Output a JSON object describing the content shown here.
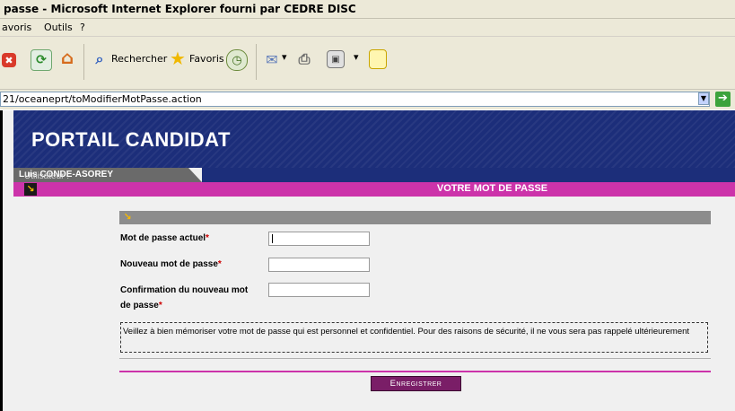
{
  "window": {
    "title": "passe - Microsoft Internet Explorer fourni par CEDRE DISC"
  },
  "menu": {
    "items": [
      "avoris",
      "Outils",
      "?"
    ]
  },
  "toolbar": {
    "search_label": "Rechercher",
    "favorites_label": "Favoris"
  },
  "address": {
    "url": "21/oceaneprt/toModifierMotPasse.action"
  },
  "portal": {
    "title": "PORTAIL CANDIDAT",
    "user_label": "Utilisateur :",
    "user_name": "Luis CONDE-ASOREY"
  },
  "section": {
    "title": "VOTRE MOT DE PASSE"
  },
  "form": {
    "current_password_label": "Mot de passe actuel",
    "new_password_label": "Nouveau mot de passe",
    "confirm_label_line1": "Confirmation du nouveau mot",
    "confirm_label_line2": "de passe",
    "required_mark": "*",
    "current_password_value": "",
    "new_password_value": "",
    "confirm_value": ""
  },
  "notice": {
    "text": "Veillez à bien mémoriser votre mot de passe qui est personnel et confidentiel. Pour des raisons de sécurité, il ne vous sera pas rappelé ultérieurement"
  },
  "actions": {
    "save_label": "Enregistrer"
  },
  "colors": {
    "banner": "#1c2e7a",
    "accent": "#cc33aa",
    "button": "#7a1e67"
  }
}
